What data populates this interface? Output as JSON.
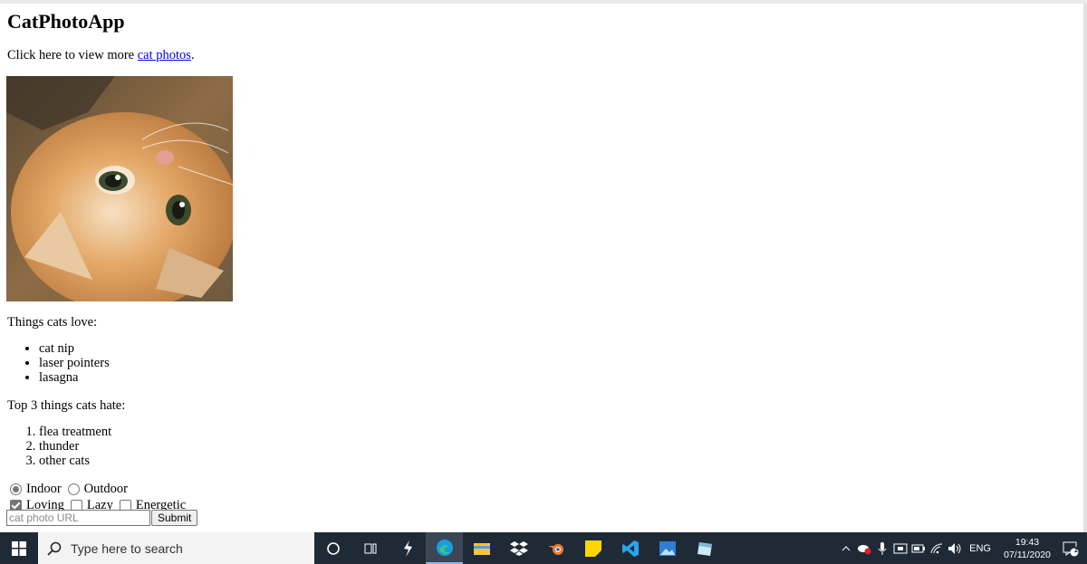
{
  "page": {
    "title": "CatPhotoApp",
    "intro_text": "Click here to view more ",
    "intro_link": "cat photos",
    "intro_end": ".",
    "image_alt": "A cute orange cat lying on its back.",
    "love_label": "Things cats love:",
    "loves": [
      "cat nip",
      "laser pointers",
      "lasagna"
    ],
    "hate_label": "Top 3 things cats hate:",
    "hates": [
      "flea treatment",
      "thunder",
      "other cats"
    ],
    "radio_indoor": "Indoor",
    "radio_outdoor": "Outdoor",
    "check_loving": "Loving",
    "check_lazy": "Lazy",
    "check_energetic": "Energetic",
    "url_placeholder": "cat photo URL",
    "submit_label": "Submit"
  },
  "taskbar": {
    "search_placeholder": "Type here to search",
    "apps": [
      "cortana-icon",
      "task-view-icon",
      "app-icon",
      "edge-icon",
      "file-explorer-icon",
      "dropbox-icon",
      "blender-icon",
      "sticky-notes-icon",
      "vscode-icon",
      "photos-icon",
      "app-icon-2"
    ],
    "language": "ENG",
    "time": "19:43",
    "date": "07/11/2020",
    "notification_count": "1"
  }
}
